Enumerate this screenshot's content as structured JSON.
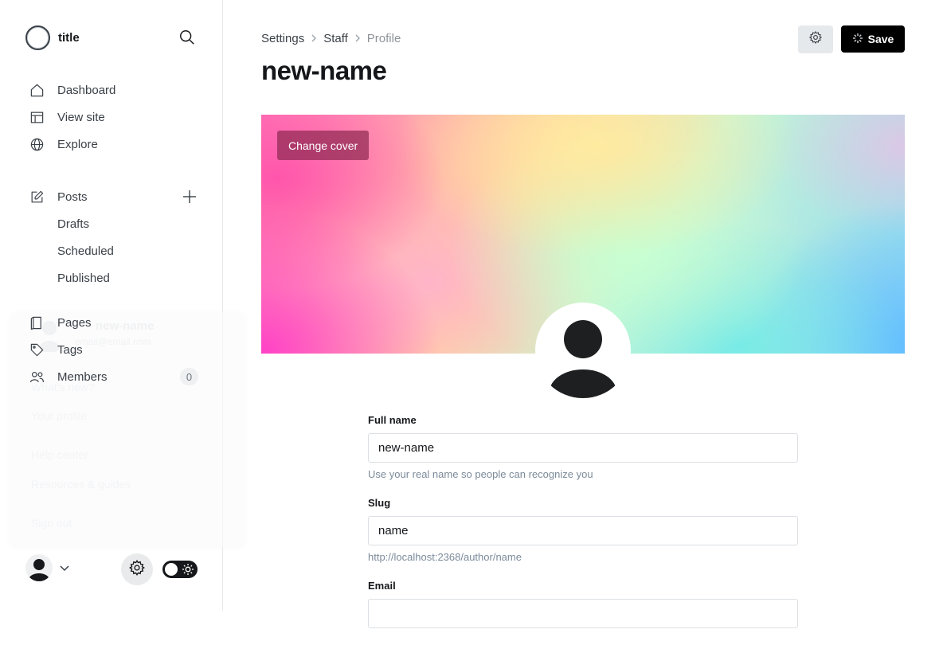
{
  "sidebar": {
    "site_title": "title",
    "nav_primary": [
      {
        "label": "Dashboard",
        "icon": "home-icon"
      },
      {
        "label": "View site",
        "icon": "layout-icon"
      },
      {
        "label": "Explore",
        "icon": "globe-icon"
      }
    ],
    "posts": {
      "label": "Posts",
      "icon": "edit-icon"
    },
    "post_subitems": [
      "Drafts",
      "Scheduled",
      "Published"
    ],
    "nav_secondary": [
      {
        "label": "Pages",
        "icon": "page-icon"
      },
      {
        "label": "Tags",
        "icon": "tag-icon"
      },
      {
        "label": "Members",
        "icon": "members-icon",
        "count": "0"
      }
    ],
    "ghost_menu": {
      "name": "new-name",
      "email": "email@email.com",
      "items": [
        "What's new?",
        "Your profile",
        "Help center",
        "Resources & guides",
        "Sign out"
      ]
    }
  },
  "header": {
    "breadcrumb": [
      "Settings",
      "Staff",
      "Profile"
    ],
    "title": "new-name",
    "save_label": "Save"
  },
  "cover": {
    "change_label": "Change cover"
  },
  "form": {
    "full_name": {
      "label": "Full name",
      "value": "new-name",
      "hint": "Use your real name so people can recognize you"
    },
    "slug": {
      "label": "Slug",
      "value": "name",
      "hint": "http://localhost:2368/author/name"
    },
    "email": {
      "label": "Email"
    }
  },
  "colors": {
    "accent": "#000000",
    "sidebar_border": "#e6e9eb",
    "hint": "#7c8b9a"
  }
}
